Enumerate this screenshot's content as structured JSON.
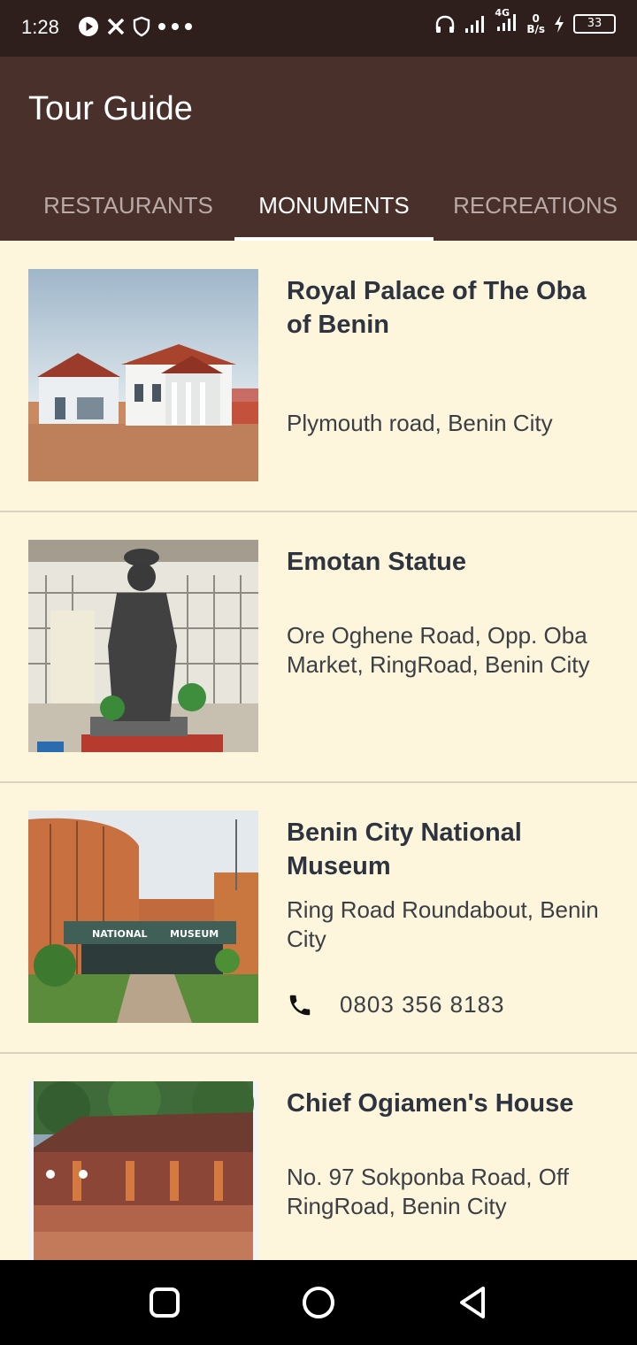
{
  "status": {
    "time": "1:28",
    "net_speed_value": "0",
    "net_speed_unit": "B/s",
    "network": "4G",
    "battery": "33"
  },
  "app": {
    "title": "Tour Guide"
  },
  "tabs": [
    {
      "label": "RESTAURANTS",
      "active": false
    },
    {
      "label": "MONUMENTS",
      "active": true
    },
    {
      "label": "RECREATIONS",
      "active": false
    }
  ],
  "monuments": [
    {
      "name": "Royal Palace of The Oba of Benin",
      "address": "Plymouth road, Benin City",
      "image": "palace-photo"
    },
    {
      "name": "Emotan Statue",
      "address": "Ore Oghene Road, Opp. Oba Market, RingRoad, Benin City",
      "image": "statue-photo"
    },
    {
      "name": "Benin City National Museum",
      "address": "Ring Road Roundabout, Benin City",
      "phone": "0803 356 8183",
      "image": "museum-photo",
      "sign_left": "NATIONAL",
      "sign_right": "MUSEUM"
    },
    {
      "name": "Chief Ogiamen's House",
      "address": "No. 97 Sokponba Road, Off RingRoad, Benin City",
      "image": "house-photo"
    }
  ],
  "nav": {
    "recents": "recents-icon",
    "home": "home-icon",
    "back": "back-icon"
  }
}
